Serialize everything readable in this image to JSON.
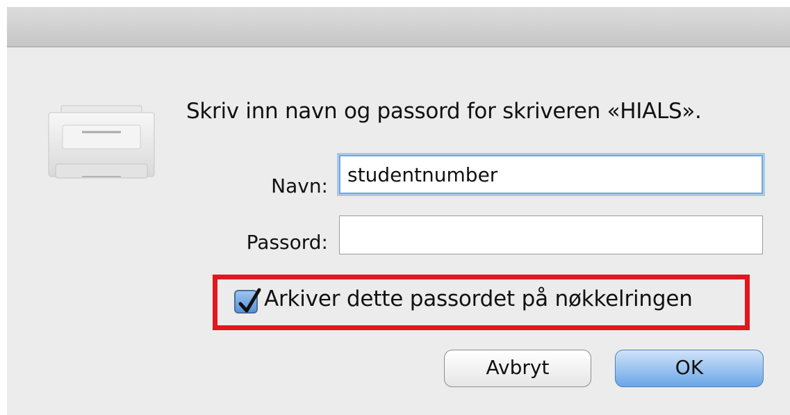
{
  "dialog": {
    "prompt": "Skriv inn navn og passord for skriveren «HIALS».",
    "name_label": "Navn:",
    "name_value": "studentnumber",
    "password_label": "Passord:",
    "password_value": "",
    "remember_label": "Arkiver dette passordet på nøkkelringen",
    "remember_checked": true,
    "cancel_label": "Avbryt",
    "ok_label": "OK"
  },
  "icons": {
    "printer": "printer-icon",
    "checkbox": "checkmark-icon"
  },
  "colors": {
    "highlight": "#e1161e",
    "focus_ring": "#7aa7d8",
    "default_button": "#6aa6e8"
  }
}
